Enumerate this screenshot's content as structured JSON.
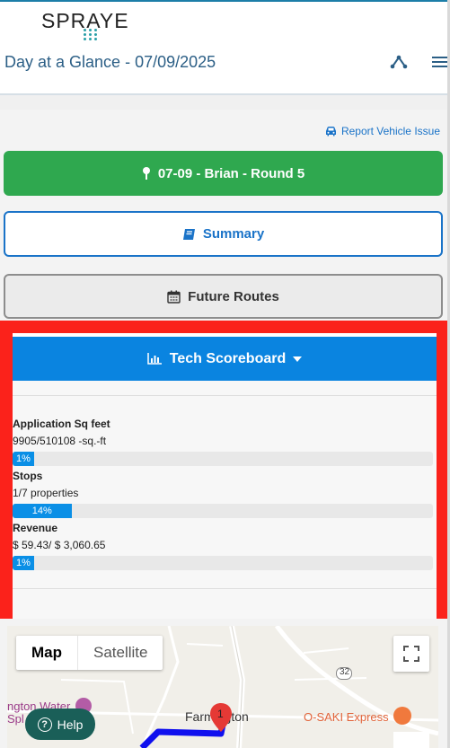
{
  "header": {
    "logo_text": "SPRAYE",
    "title": "Day at a Glance - 07/09/2025",
    "icons": {
      "routes": "route-network-icon",
      "menu": "hamburger-menu-icon"
    }
  },
  "actions": {
    "report_vehicle_issue": "Report Vehicle Issue",
    "route_button": "07-09 - Brian - Round 5",
    "summary_button": "Summary",
    "future_routes_button": "Future Routes"
  },
  "scoreboard": {
    "title": "Tech Scoreboard",
    "metrics": [
      {
        "label": "Application Sq feet",
        "value": "9905/510108 -sq.-ft",
        "percent_label": "1%",
        "progress": 1
      },
      {
        "label": "Stops",
        "value": "1/7 properties",
        "percent_label": "14%",
        "progress": 14
      },
      {
        "label": "Revenue",
        "value": "$ 59.43/ $ 3,060.65",
        "percent_label": "1%",
        "progress": 1
      }
    ]
  },
  "map": {
    "tab_map": "Map",
    "tab_satellite": "Satellite",
    "active_tab": "Map",
    "labels": {
      "place_left": "ngton Water",
      "place_left2": "Spl",
      "town": "Farmington",
      "business": "O-SAKI Express",
      "road": "32",
      "marker": "1"
    },
    "help_label": "Help"
  },
  "colors": {
    "primary_blue": "#0a84e0",
    "success_green": "#2fa84f",
    "highlight_red": "#fb221b",
    "help_teal": "#1a5f58"
  }
}
